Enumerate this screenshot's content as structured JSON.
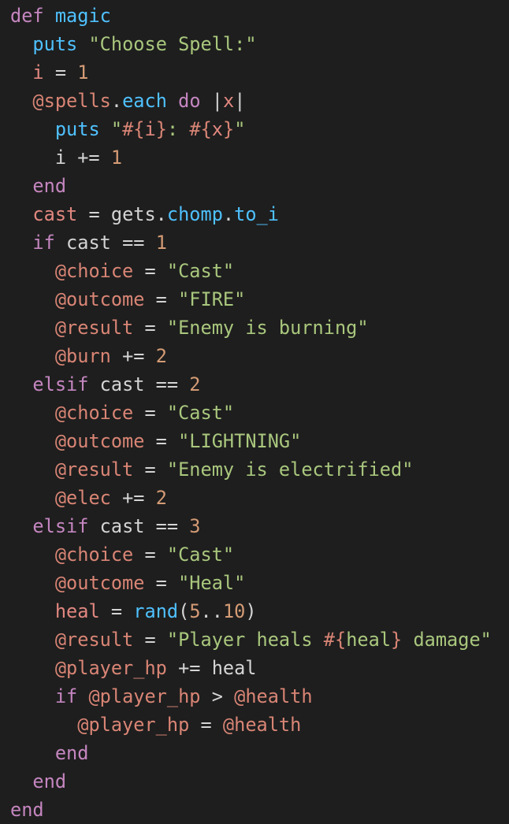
{
  "editor": {
    "language": "ruby",
    "colors": {
      "background": "#1e1e1e",
      "default": "#d4d4d4",
      "keyword": "#c586c0",
      "method": "#4fc1ff",
      "string": "#a9c77d",
      "number": "#d49b75",
      "ivar": "#d98575",
      "local": "#e28880"
    },
    "lines": [
      [
        [
          "keyword",
          "def"
        ],
        [
          "plain",
          " "
        ],
        [
          "method",
          "magic"
        ]
      ],
      [
        [
          "plain",
          "  "
        ],
        [
          "method",
          "puts"
        ],
        [
          "plain",
          " "
        ],
        [
          "string",
          "\"Choose Spell:\""
        ]
      ],
      [
        [
          "plain",
          "  "
        ],
        [
          "local",
          "i"
        ],
        [
          "plain",
          " = "
        ],
        [
          "number",
          "1"
        ]
      ],
      [
        [
          "plain",
          "  "
        ],
        [
          "ivar",
          "@spells"
        ],
        [
          "plain",
          "."
        ],
        [
          "method",
          "each"
        ],
        [
          "plain",
          " "
        ],
        [
          "keyword",
          "do"
        ],
        [
          "plain",
          " |"
        ],
        [
          "local",
          "x"
        ],
        [
          "plain",
          "|"
        ]
      ],
      [
        [
          "plain",
          "    "
        ],
        [
          "method",
          "puts"
        ],
        [
          "plain",
          " "
        ],
        [
          "string",
          "\""
        ],
        [
          "ivar",
          "#{"
        ],
        [
          "local",
          "i"
        ],
        [
          "ivar",
          "}"
        ],
        [
          "string",
          ": "
        ],
        [
          "ivar",
          "#{"
        ],
        [
          "local",
          "x"
        ],
        [
          "ivar",
          "}"
        ],
        [
          "string",
          "\""
        ]
      ],
      [
        [
          "plain",
          "    i += "
        ],
        [
          "number",
          "1"
        ]
      ],
      [
        [
          "plain",
          "  "
        ],
        [
          "keyword",
          "end"
        ]
      ],
      [
        [
          "plain",
          "  "
        ],
        [
          "local",
          "cast"
        ],
        [
          "plain",
          " = gets."
        ],
        [
          "method",
          "chomp"
        ],
        [
          "plain",
          "."
        ],
        [
          "method",
          "to_i"
        ]
      ],
      [
        [
          "plain",
          "  "
        ],
        [
          "keyword",
          "if"
        ],
        [
          "plain",
          " cast == "
        ],
        [
          "number",
          "1"
        ]
      ],
      [
        [
          "plain",
          "    "
        ],
        [
          "ivar",
          "@choice"
        ],
        [
          "plain",
          " = "
        ],
        [
          "string",
          "\"Cast\""
        ]
      ],
      [
        [
          "plain",
          "    "
        ],
        [
          "ivar",
          "@outcome"
        ],
        [
          "plain",
          " = "
        ],
        [
          "string",
          "\"FIRE\""
        ]
      ],
      [
        [
          "plain",
          "    "
        ],
        [
          "ivar",
          "@result"
        ],
        [
          "plain",
          " = "
        ],
        [
          "string",
          "\"Enemy is burning\""
        ]
      ],
      [
        [
          "plain",
          "    "
        ],
        [
          "ivar",
          "@burn"
        ],
        [
          "plain",
          " += "
        ],
        [
          "number",
          "2"
        ]
      ],
      [
        [
          "plain",
          "  "
        ],
        [
          "keyword",
          "elsif"
        ],
        [
          "plain",
          " cast == "
        ],
        [
          "number",
          "2"
        ]
      ],
      [
        [
          "plain",
          "    "
        ],
        [
          "ivar",
          "@choice"
        ],
        [
          "plain",
          " = "
        ],
        [
          "string",
          "\"Cast\""
        ]
      ],
      [
        [
          "plain",
          "    "
        ],
        [
          "ivar",
          "@outcome"
        ],
        [
          "plain",
          " = "
        ],
        [
          "string",
          "\"LIGHTNING\""
        ]
      ],
      [
        [
          "plain",
          "    "
        ],
        [
          "ivar",
          "@result"
        ],
        [
          "plain",
          " = "
        ],
        [
          "string",
          "\"Enemy is electrified\""
        ]
      ],
      [
        [
          "plain",
          "    "
        ],
        [
          "ivar",
          "@elec"
        ],
        [
          "plain",
          " += "
        ],
        [
          "number",
          "2"
        ]
      ],
      [
        [
          "plain",
          "  "
        ],
        [
          "keyword",
          "elsif"
        ],
        [
          "plain",
          " cast == "
        ],
        [
          "number",
          "3"
        ]
      ],
      [
        [
          "plain",
          "    "
        ],
        [
          "ivar",
          "@choice"
        ],
        [
          "plain",
          " = "
        ],
        [
          "string",
          "\"Cast\""
        ]
      ],
      [
        [
          "plain",
          "    "
        ],
        [
          "ivar",
          "@outcome"
        ],
        [
          "plain",
          " = "
        ],
        [
          "string",
          "\"Heal\""
        ]
      ],
      [
        [
          "plain",
          "    "
        ],
        [
          "local",
          "heal"
        ],
        [
          "plain",
          " = "
        ],
        [
          "method",
          "rand"
        ],
        [
          "plain",
          "("
        ],
        [
          "number",
          "5"
        ],
        [
          "plain",
          ".."
        ],
        [
          "number",
          "10"
        ],
        [
          "plain",
          ")"
        ]
      ],
      [
        [
          "plain",
          "    "
        ],
        [
          "ivar",
          "@result"
        ],
        [
          "plain",
          " = "
        ],
        [
          "string",
          "\"Player heals "
        ],
        [
          "ivar",
          "#{"
        ],
        [
          "string",
          "heal"
        ],
        [
          "ivar",
          "}"
        ],
        [
          "string",
          " damage\""
        ]
      ],
      [
        [
          "plain",
          "    "
        ],
        [
          "ivar",
          "@player_hp"
        ],
        [
          "plain",
          " += heal"
        ]
      ],
      [
        [
          "plain",
          "    "
        ],
        [
          "keyword",
          "if"
        ],
        [
          "plain",
          " "
        ],
        [
          "ivar",
          "@player_hp"
        ],
        [
          "plain",
          " > "
        ],
        [
          "ivar",
          "@health"
        ]
      ],
      [
        [
          "plain",
          "      "
        ],
        [
          "ivar",
          "@player_hp"
        ],
        [
          "plain",
          " = "
        ],
        [
          "ivar",
          "@health"
        ]
      ],
      [
        [
          "plain",
          "    "
        ],
        [
          "keyword",
          "end"
        ]
      ],
      [
        [
          "plain",
          "  "
        ],
        [
          "keyword",
          "end"
        ]
      ],
      [
        [
          "keyword",
          "end"
        ]
      ]
    ]
  }
}
